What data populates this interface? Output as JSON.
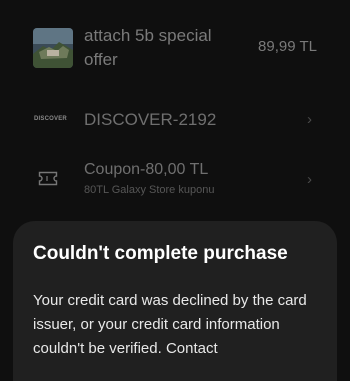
{
  "product": {
    "title": "attach 5b special offer",
    "price": "89,99 TL"
  },
  "payment_card": {
    "brand": "DISCOVER",
    "number": "DISCOVER-2192"
  },
  "coupon": {
    "title": "Coupon-80,00 TL",
    "subtitle": "80TL Galaxy Store kuponu"
  },
  "dialog": {
    "title": "Couldn't complete purchase",
    "message": "Your credit card was declined by the card issuer, or your credit card information couldn't be verified. Contact"
  }
}
